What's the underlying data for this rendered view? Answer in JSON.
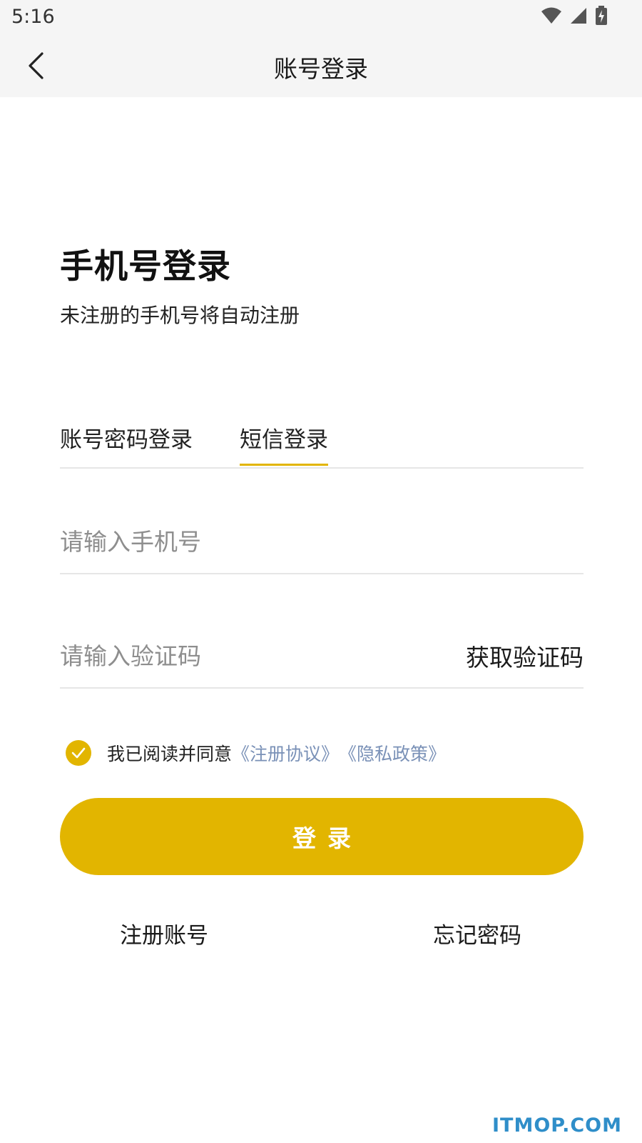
{
  "status_bar": {
    "time": "5:16",
    "icons": [
      "wifi-icon",
      "signal-icon",
      "battery-charging-icon"
    ]
  },
  "nav": {
    "title": "账号登录",
    "back_icon": "chevron-left-icon"
  },
  "header": {
    "title": "手机号登录",
    "subtitle": "未注册的手机号将自动注册"
  },
  "tabs": [
    {
      "label": "账号密码登录",
      "active": false
    },
    {
      "label": "短信登录",
      "active": true
    }
  ],
  "form": {
    "phone_placeholder": "请输入手机号",
    "code_placeholder": "请输入验证码",
    "get_code_label": "获取验证码"
  },
  "agreement": {
    "checked": true,
    "text": "我已阅读并同意",
    "terms_link": "《注册协议》",
    "privacy_link": "《隐私政策》"
  },
  "login_button": "登录",
  "footer": {
    "register": "注册账号",
    "forgot": "忘记密码"
  },
  "watermark": "ITMOP.COM",
  "colors": {
    "accent": "#e2b500",
    "link": "#7a91b7",
    "watermark": "#2f8ec9"
  }
}
